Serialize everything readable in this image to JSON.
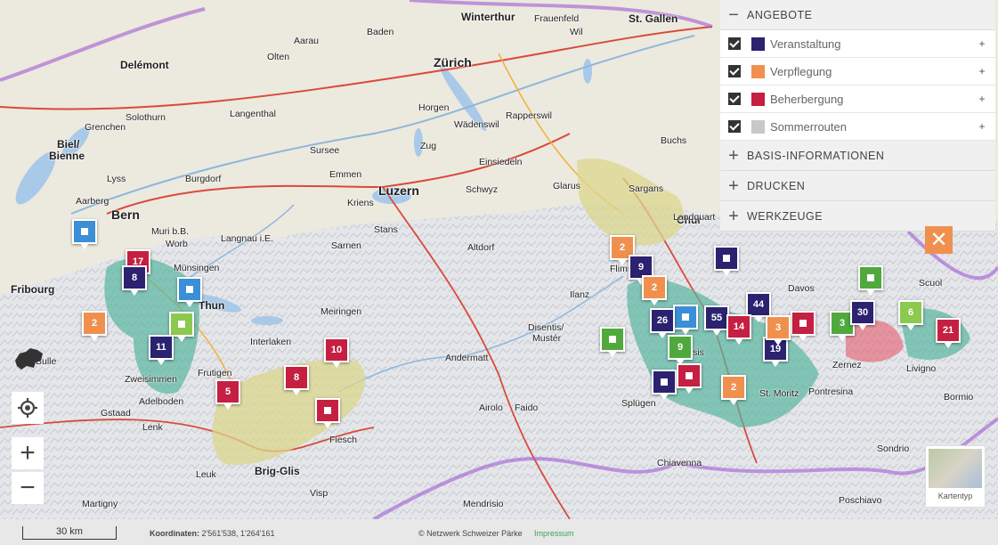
{
  "panel": {
    "sections": [
      {
        "label": "ANGEBOTE",
        "symbol": "−"
      },
      {
        "label": "BASIS-INFORMATIONEN",
        "symbol": "+"
      },
      {
        "label": "DRUCKEN",
        "symbol": "+"
      },
      {
        "label": "WERKZEUGE",
        "symbol": "+"
      }
    ],
    "layers": [
      {
        "label": "Veranstaltung",
        "color": "#2b2270",
        "checked": true,
        "expand": "+"
      },
      {
        "label": "Verpflegung",
        "color": "#f0904f",
        "checked": true,
        "expand": "+"
      },
      {
        "label": "Beherbergung",
        "color": "#c51f41",
        "checked": true,
        "expand": "+"
      },
      {
        "label": "Sommerrouten",
        "color": "#c8c8c8",
        "checked": true,
        "expand": "+"
      }
    ],
    "close_symbol": "✕"
  },
  "controls": {
    "zoom_in": "+",
    "zoom_out": "−"
  },
  "maptype": {
    "label": "Kartentyp"
  },
  "scale": {
    "label": "30 km"
  },
  "coords": {
    "label": "Koordinaten:",
    "value": "2'561'538, 1'264'161"
  },
  "footer": {
    "copyright": "© Netzwerk Schweizer Pärke",
    "impressum": "Impressum"
  },
  "markers": [
    "17",
    "8",
    "2",
    "11",
    "10",
    "8",
    "5",
    "2",
    "9",
    "2",
    "26",
    "55",
    "44",
    "14",
    "19",
    "3",
    "3",
    "30",
    "6",
    "21",
    "2",
    "9"
  ],
  "places": {
    "p01": "Zürich",
    "p02": "Winterthur",
    "p03": "St. Gallen",
    "p04": "Aarau",
    "p05": "Olten",
    "p06": "Biel/",
    "p07": "Bienne",
    "p08": "Solothurn",
    "p09": "Bern",
    "p10": "Luzern",
    "p11": "Zug",
    "p12": "Schwyz",
    "p13": "Davos",
    "p14": "Chur",
    "p15": "Glarus",
    "p16": "Thun",
    "p17": "Interlaken",
    "p18": "Fribourg",
    "p19": "Brig-Glis",
    "p20": "Andermatt",
    "p21": "Scuol",
    "p22": "St. Moritz",
    "p23": "Poschiavo",
    "p24": "Delémont",
    "p25": "Baden",
    "p26": "Frauenfeld",
    "p27": "Wil",
    "p28": "Langnau i.E.",
    "p29": "Burgdorf",
    "p30": "Sursee",
    "p31": "Einsiedeln",
    "p32": "Altdorf",
    "p33": "Disentis/",
    "p34": "Mustér",
    "p35": "Flims",
    "p36": "Zweisimmen",
    "p37": "Adelboden",
    "p38": "Gstaad",
    "p39": "Frutigen",
    "p40": "Airolo",
    "p41": "Splügen",
    "p42": "Bormio",
    "p43": "Livigno",
    "p44": "Chiavenna",
    "p45": "Sondrio",
    "p46": "Visp",
    "p47": "Leuk",
    "p48": "Martigny",
    "p49": "Grenchen",
    "p50": "Langenthal",
    "p51": "Rapperswil",
    "p52": "Wädenswil",
    "p53": "Horgen",
    "p54": "Meiringen",
    "p55": "Sarnen",
    "p56": "Stans",
    "p57": "Kriens",
    "p58": "Emmen",
    "p59": "Mendrisio",
    "p60": "Faido",
    "p61": "Sargans",
    "p62": "Landquart",
    "p63": "Buchs",
    "p64": "Lenk",
    "p65": "Fiesch",
    "p66": "Zernez",
    "p67": "Pontresina",
    "p68": "Münsingen",
    "p69": "Worb",
    "p70": "Muri b.B.",
    "p71": "Bulle",
    "p72": "Lyss",
    "p73": "Aarberg",
    "p74": "Ilanz",
    "p75": "Thusis"
  }
}
